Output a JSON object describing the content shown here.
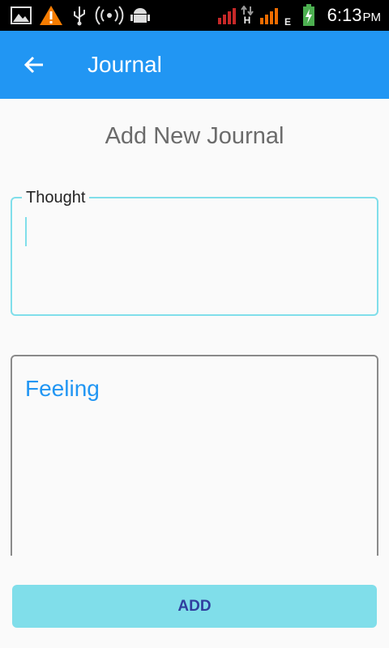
{
  "status_bar": {
    "time": "6:13",
    "ampm": "PM",
    "icons": [
      "image-icon",
      "warning-icon",
      "usb-icon",
      "hotspot-icon",
      "android-icon",
      "signal-icon",
      "data-h-icon",
      "signal-icon",
      "data-e-icon",
      "battery-charging-icon"
    ],
    "network_h": "H",
    "network_e": "E"
  },
  "app_bar": {
    "title": "Journal",
    "color": "#2196f3"
  },
  "page": {
    "heading": "Add New Journal"
  },
  "form": {
    "thought": {
      "label": "Thought",
      "value": ""
    },
    "feeling": {
      "placeholder": "Feeling",
      "value": ""
    },
    "add_label": "ADD"
  },
  "colors": {
    "accent": "#80deea",
    "primary": "#2196f3",
    "button_text": "#303f9f"
  }
}
